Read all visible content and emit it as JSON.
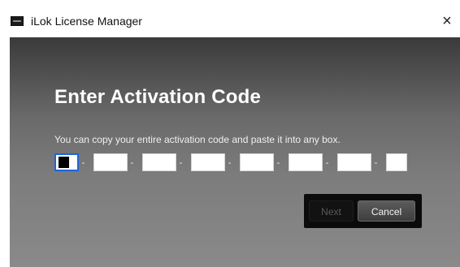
{
  "window": {
    "title": "iLok License Manager",
    "close_glyph": "×",
    "app_icon": "ilok-app-icon"
  },
  "dialog": {
    "heading": "Enter Activation Code",
    "instructions": "You can copy your entire activation code and paste it into any box.",
    "code_boxes": [
      {
        "value": "",
        "focused": true
      },
      {
        "value": "",
        "focused": false
      },
      {
        "value": "",
        "focused": false
      },
      {
        "value": "",
        "focused": false
      },
      {
        "value": "",
        "focused": false
      },
      {
        "value": "",
        "focused": false
      },
      {
        "value": "",
        "focused": false
      },
      {
        "value": "",
        "focused": false
      }
    ],
    "separator": "-",
    "buttons": {
      "next_label": "Next",
      "next_enabled": false,
      "cancel_label": "Cancel"
    }
  },
  "colors": {
    "focus_border": "#1e64d8",
    "heading_text": "#ffffff",
    "panel_top": "#3a3a3a",
    "panel_bottom": "#8a8a8a"
  }
}
